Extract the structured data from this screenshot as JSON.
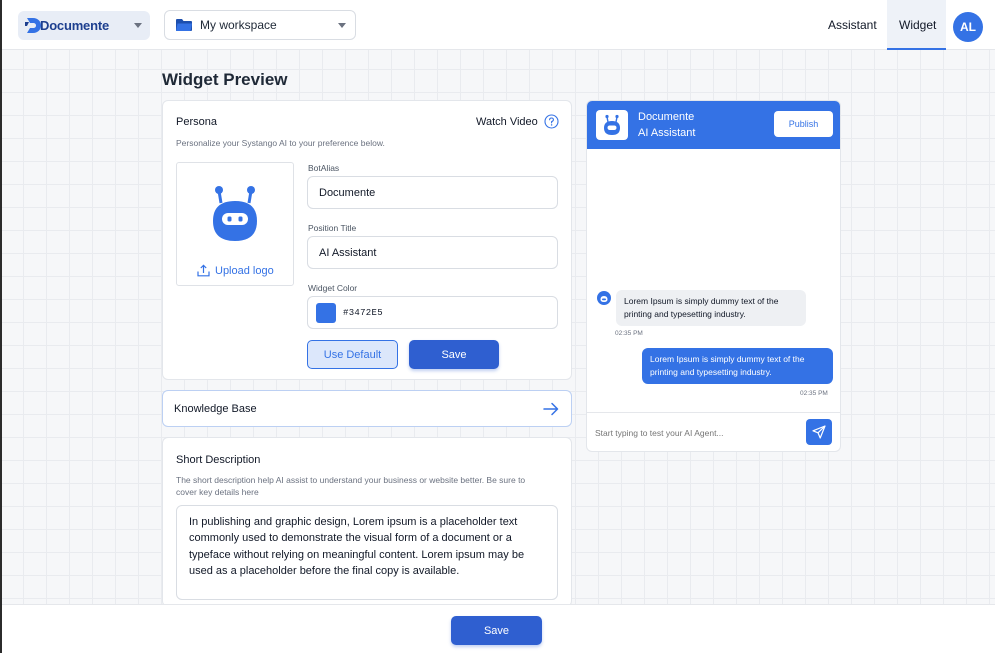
{
  "header": {
    "brand": {
      "name": "Documente",
      "icon": "documente-logo-icon"
    },
    "workspace": {
      "label": "My workspace",
      "icon": "folder-icon"
    },
    "nav": [
      {
        "label": "Assistant",
        "active": false
      },
      {
        "label": "Widget",
        "active": true
      }
    ],
    "avatar_initials": "AL"
  },
  "page": {
    "title": "Widget Preview"
  },
  "persona": {
    "title": "Persona",
    "watch_video": "Watch Video",
    "subtitle": "Personalize your Systango AI to your preference below.",
    "upload_label": "Upload logo",
    "bot_alias": {
      "label": "BotAlias",
      "value": "Documente"
    },
    "position_title": {
      "label": "Position Title",
      "value": "AI Assistant"
    },
    "widget_color": {
      "label": "Widget Color",
      "value": "#3472E5"
    },
    "use_default_label": "Use Default",
    "save_label": "Save"
  },
  "knowledge_base": {
    "label": "Knowledge Base"
  },
  "short_description": {
    "title": "Short Description",
    "subtitle": "The short description help AI assist to understand your business or website better. Be sure to cover key details here",
    "value": "In publishing and graphic design, Lorem ipsum is a placeholder text commonly used to demonstrate the visual form of a document or a typeface without relying on meaningful content. Lorem ipsum may be used as a placeholder before the final copy is available."
  },
  "chat_preview": {
    "bot_name": "Documente",
    "bot_role": "AI Assistant",
    "publish_label": "Publish",
    "messages": [
      {
        "from": "bot",
        "text": "Lorem Ipsum is simply dummy text of the printing and typesetting industry.",
        "time": "02:35 PM"
      },
      {
        "from": "user",
        "text": "Lorem Ipsum is simply dummy text of the printing and typesetting industry.",
        "time": "02:35 PM"
      }
    ],
    "input_placeholder": "Start typing to test your AI Agent..."
  },
  "footer": {
    "save_label": "Save"
  },
  "colors": {
    "accent": "#3472e5",
    "button": "#2f5fd0",
    "brand_dark": "#1d3f8f"
  }
}
